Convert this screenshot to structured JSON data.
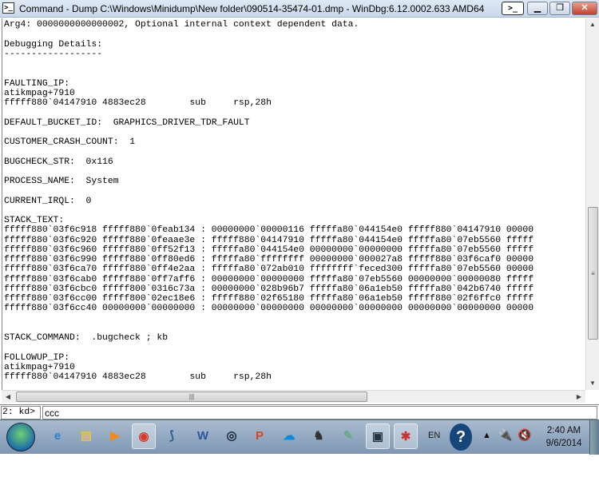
{
  "window": {
    "title": "Command - Dump C:\\Windows\\Minidump\\New folder\\090514-35474-01.dmp - WinDbg:6.12.0002.633 AMD64",
    "icon": "console-prompt-icon",
    "buttons": {
      "cmd": "command-window-icon",
      "minimize": "minimize-icon",
      "restore": "restore-icon",
      "close": "close-icon"
    }
  },
  "output": {
    "lines": [
      "Arg4: 0000000000000002, Optional internal context dependent data.",
      "",
      "Debugging Details:",
      "------------------",
      "",
      "",
      "FAULTING_IP: ",
      "atikmpag+7910",
      "fffff880`04147910 4883ec28        sub     rsp,28h",
      "",
      "DEFAULT_BUCKET_ID:  GRAPHICS_DRIVER_TDR_FAULT",
      "",
      "CUSTOMER_CRASH_COUNT:  1",
      "",
      "BUGCHECK_STR:  0x116",
      "",
      "PROCESS_NAME:  System",
      "",
      "CURRENT_IRQL:  0",
      "",
      "STACK_TEXT:  ",
      "fffff880`03f6c918 fffff880`0feab134 : 00000000`00000116 fffffa80`044154e0 fffff880`04147910 00000",
      "fffff880`03f6c920 fffff880`0feaae3e : fffff880`04147910 fffffa80`044154e0 fffffa80`07eb5560 fffff",
      "fffff880`03f6c960 fffff880`0ff52f13 : fffffa80`044154e0 00000000`00000000 fffffa80`07eb5560 fffff",
      "fffff880`03f6c990 fffff880`0ff80ed6 : fffffa80`ffffffff 00000000`000027a8 fffff880`03f6caf0 00000",
      "fffff880`03f6ca70 fffff880`0ff4e2aa : fffffa80`072ab010 ffffffff`feced300 fffffa80`07eb5560 00000",
      "fffff880`03f6cab0 fffff880`0ff7aff6 : 00000000`00000000 fffffa80`07eb5560 00000000`00000080 fffff",
      "fffff880`03f6cbc0 fffff800`0316c73a : 00000000`028b96b7 fffffa80`06a1eb50 fffffa80`042b6740 fffff",
      "fffff880`03f6cc00 fffff800`02ec18e6 : fffff880`02f65180 fffffa80`06a1eb50 fffff880`02f6ffc0 fffff",
      "fffff880`03f6cc40 00000000`00000000 : 00000000`00000000 00000000`00000000 00000000`00000000 00000",
      "",
      "",
      "STACK_COMMAND:  .bugcheck ; kb",
      "",
      "FOLLOWUP_IP: ",
      "atikmpag+7910",
      "fffff880`04147910 4883ec28        sub     rsp,28h"
    ]
  },
  "command": {
    "prompt": "2: kd>",
    "value": "ccc"
  },
  "taskbar": {
    "start": "windows-start-icon",
    "apps": [
      {
        "name": "internet-explorer",
        "glyph": "e",
        "color": "#2b7cd3",
        "active": false
      },
      {
        "name": "file-explorer",
        "glyph": "▤",
        "color": "#e8c34a",
        "active": false
      },
      {
        "name": "media-player",
        "glyph": "▶",
        "color": "#f08a1c",
        "active": false
      },
      {
        "name": "chrome",
        "glyph": "◉",
        "color": "#d33c2c",
        "active": true
      },
      {
        "name": "network-app",
        "glyph": "⟆",
        "color": "#2a5d8a",
        "active": false
      },
      {
        "name": "word",
        "glyph": "W",
        "color": "#2b579a",
        "active": false
      },
      {
        "name": "steam",
        "glyph": "◎",
        "color": "#1b2838",
        "active": false
      },
      {
        "name": "powerpoint",
        "glyph": "P",
        "color": "#d24726",
        "active": false
      },
      {
        "name": "cloud-app",
        "glyph": "☁",
        "color": "#0a8ad6",
        "active": false
      },
      {
        "name": "game-app",
        "glyph": "♞",
        "color": "#333",
        "active": false
      },
      {
        "name": "tool-app",
        "glyph": "✎",
        "color": "#6a8",
        "active": false
      },
      {
        "name": "windbg",
        "glyph": "▣",
        "color": "#234",
        "active": true
      },
      {
        "name": "crash-app",
        "glyph": "✱",
        "color": "#c33",
        "active": true
      }
    ],
    "language": "EN",
    "time": "2:40 AM",
    "date": "9/6/2014"
  }
}
